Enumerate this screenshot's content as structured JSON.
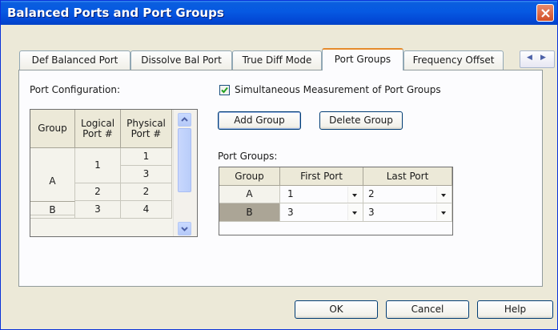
{
  "window": {
    "title": "Balanced Ports and Port Groups"
  },
  "tabs": [
    {
      "label": "Def Balanced Port"
    },
    {
      "label": "Dissolve Bal Port"
    },
    {
      "label": "True Diff Mode"
    },
    {
      "label": "Port Groups",
      "active": true
    },
    {
      "label": "Frequency Offset"
    }
  ],
  "port_config": {
    "label": "Port Configuration:",
    "headers": {
      "group": "Group",
      "logical": "Logical\nPort #",
      "physical": "Physical\nPort #"
    },
    "rows": [
      {
        "group": "A",
        "logical": "1",
        "physical": [
          "1",
          "3"
        ]
      },
      {
        "group": "",
        "logical": "2",
        "physical": [
          "2"
        ]
      },
      {
        "group": "B",
        "logical": "3",
        "physical": [
          "4"
        ]
      }
    ]
  },
  "simultaneous": {
    "label": "Simultaneous Measurement of Port Groups",
    "checked": true
  },
  "buttons": {
    "add_group": "Add Group",
    "delete_group": "Delete Group",
    "ok": "OK",
    "cancel": "Cancel",
    "help": "Help"
  },
  "port_groups": {
    "label": "Port Groups:",
    "headers": {
      "group": "Group",
      "first": "First Port",
      "last": "Last Port"
    },
    "rows": [
      {
        "group": "A",
        "first": "1",
        "last": "2"
      },
      {
        "group": "B",
        "first": "3",
        "last": "3"
      }
    ]
  },
  "colors": {
    "titlebar": "#0659e2",
    "selected_row": "#aba596",
    "active_tab_highlight": "#e68b2c"
  },
  "icons": {
    "close": "close-x-icon",
    "tab_scroll_left": "chevron-left-icon",
    "tab_scroll_right": "chevron-right-icon",
    "scroll_up": "chevron-up-icon",
    "scroll_down": "chevron-down-icon",
    "checkbox": "check-icon",
    "dropdown": "dropdown-arrow-icon"
  }
}
